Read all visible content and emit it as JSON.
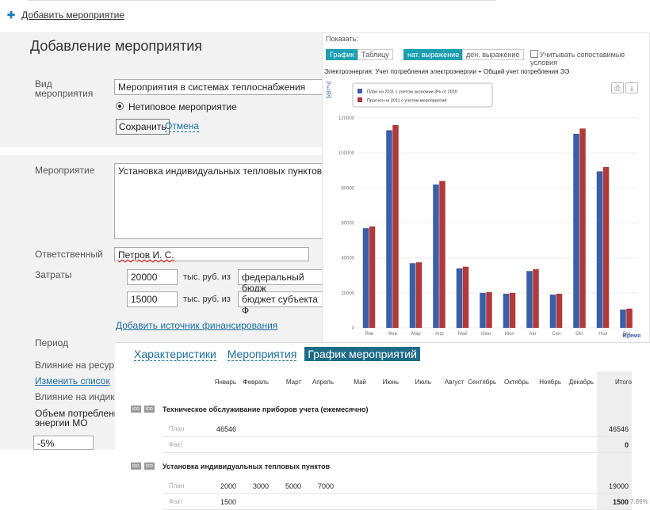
{
  "top": {
    "add_event": "Добавить мероприятие"
  },
  "form1": {
    "title": "Добавление мероприятия",
    "type_label": "Вид мероприятия",
    "type_value": "Мероприятия в системах теплоснабжения",
    "radio_label": "Нетиповое мероприятие",
    "save": "Сохранить",
    "cancel": "Отмена"
  },
  "form2": {
    "event_label": "Мероприятие",
    "event_value": "Установка индивидуальных тепловых пунктов",
    "responsible_label": "Ответственный",
    "responsible_value": "Петров И. С.",
    "costs_label": "Затраты",
    "cost1": "20000",
    "cost2": "15000",
    "unit": "тыс. руб. из",
    "source1": "федеральный бюдж",
    "source2": "бюджет субъекта Ф",
    "add_source": "Добавить источник финансирования",
    "period_label": "Период",
    "influence_res": "Влияние на ресур",
    "change_list": "Изменить список",
    "influence_ind": "Влияние на индик",
    "volume_label_1": "Объем потреблени",
    "volume_label_2": "энергии МО",
    "volume_value": "-5%"
  },
  "chart": {
    "show_label": "Показать:",
    "btn_graph": "График",
    "btn_table": "Таблицу",
    "btn_nat": "нат. выражение",
    "btn_money": "ден. выражение",
    "checkbox_label": "Учитывать сопоставимые условия",
    "title": "Электроэнергия: Учет потребления электроэнергии + Общий учет потребления ЭЭ",
    "y_unit": "[кВт*ч]",
    "x_label": "Время",
    "colors": {
      "plan": "#3a5fa8",
      "forecast": "#b03a3a"
    }
  },
  "chart_data": {
    "type": "bar",
    "categories": [
      "Янв",
      "Фев",
      "Мар",
      "Апр",
      "Май",
      "Июн",
      "Июл",
      "Авг",
      "Сен",
      "Окт",
      "Ноя",
      "Дек"
    ],
    "series": [
      {
        "name": "План на 2011 с учетом экономии 3% от 2010",
        "values": [
          57000,
          113000,
          37000,
          82000,
          34000,
          20000,
          19500,
          32500,
          19000,
          111000,
          89500,
          10500
        ]
      },
      {
        "name": "Прогноз на 2011 с учетом мероприятий",
        "values": [
          58000,
          116000,
          37500,
          84000,
          35000,
          20500,
          20000,
          33500,
          19500,
          114000,
          92000,
          11000
        ]
      }
    ],
    "yticks": [
      0,
      20000,
      40000,
      60000,
      80000,
      100000,
      120000
    ],
    "ylim": [
      0,
      125000
    ]
  },
  "schedule": {
    "tabs": [
      "Характеристики",
      "Мероприятия",
      "График мероприятий"
    ],
    "months": [
      "Январь",
      "Февраль",
      "Март",
      "Апрель",
      "Май",
      "Июнь",
      "Июль",
      "Август",
      "Сентябрь",
      "Октябрь",
      "Ноябрь",
      "Декабрь"
    ],
    "total_label": "Итого",
    "ico": "ico",
    "plan_label": "План",
    "fact_label": "Факт",
    "rows": [
      {
        "title": "Техническое обслуживание приборов учета (ежемесячно)",
        "plan": [
          "46546",
          "",
          "",
          "",
          "",
          "",
          "",
          "",
          "",
          "",
          "",
          ""
        ],
        "plan_total": "46546",
        "fact": [
          "",
          "",
          "",
          "",
          "",
          "",
          "",
          "",
          "",
          "",
          "",
          ""
        ],
        "fact_total": "0",
        "fact_pct": ""
      },
      {
        "title": "Установка индивидуальных тепловых пунктов",
        "plan": [
          "2000",
          "3000",
          "5000",
          "7000",
          "",
          "",
          "",
          "",
          "",
          "",
          "",
          ""
        ],
        "plan_total": "19000",
        "fact": [
          "1500",
          "",
          "",
          "",
          "",
          "",
          "",
          "",
          "",
          "",
          "",
          ""
        ],
        "fact_total": "1500",
        "fact_pct": "7.89%"
      }
    ]
  }
}
